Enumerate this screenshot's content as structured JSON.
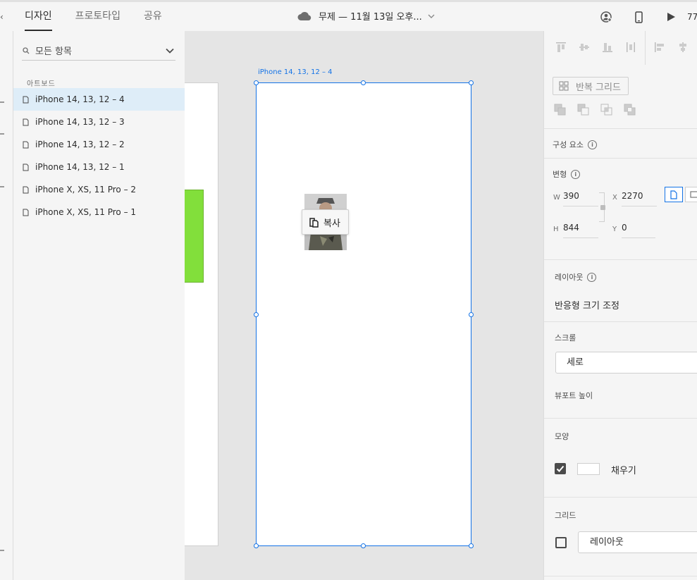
{
  "topbar": {
    "tabs": [
      {
        "label": "디자인",
        "active": true
      },
      {
        "label": "프로토타입",
        "active": false
      },
      {
        "label": "공유",
        "active": false
      }
    ],
    "doc_title": "무제 — 11월 13일 오후...",
    "zoom": "77"
  },
  "layers": {
    "search_placeholder": "모든 항목",
    "section_label": "아트보드",
    "items": [
      {
        "label": "iPhone 14, 13, 12 – 4",
        "selected": true
      },
      {
        "label": "iPhone 14, 13, 12 – 3",
        "selected": false
      },
      {
        "label": "iPhone 14, 13, 12 – 2",
        "selected": false
      },
      {
        "label": "iPhone 14, 13, 12 – 1",
        "selected": false
      },
      {
        "label": "iPhone X, XS, 11 Pro – 2",
        "selected": false
      },
      {
        "label": "iPhone X, XS, 11 Pro – 1",
        "selected": false
      }
    ]
  },
  "canvas": {
    "artboard_label": "iPhone 14, 13, 12 – 4",
    "tooltip_label": "복사",
    "green_color": "#82df3b",
    "selection_color": "#1473e6"
  },
  "props": {
    "repeat_grid": "반복 그리드",
    "components": "구성 요소",
    "transform": "변형",
    "w_label": "W",
    "w_value": "390",
    "x_label": "X",
    "x_value": "2270",
    "h_label": "H",
    "h_value": "844",
    "y_label": "Y",
    "y_value": "0",
    "layout": "레이아웃",
    "responsive_resize": "반응형 크기 조정",
    "scroll": "스크롤",
    "scroll_value": "세로",
    "viewport_height": "뷰포트 높이",
    "appearance": "모양",
    "fill_label": "채우기",
    "fill_checked": true,
    "grid": "그리드",
    "grid_checked": false,
    "grid_value": "레이아웃"
  }
}
